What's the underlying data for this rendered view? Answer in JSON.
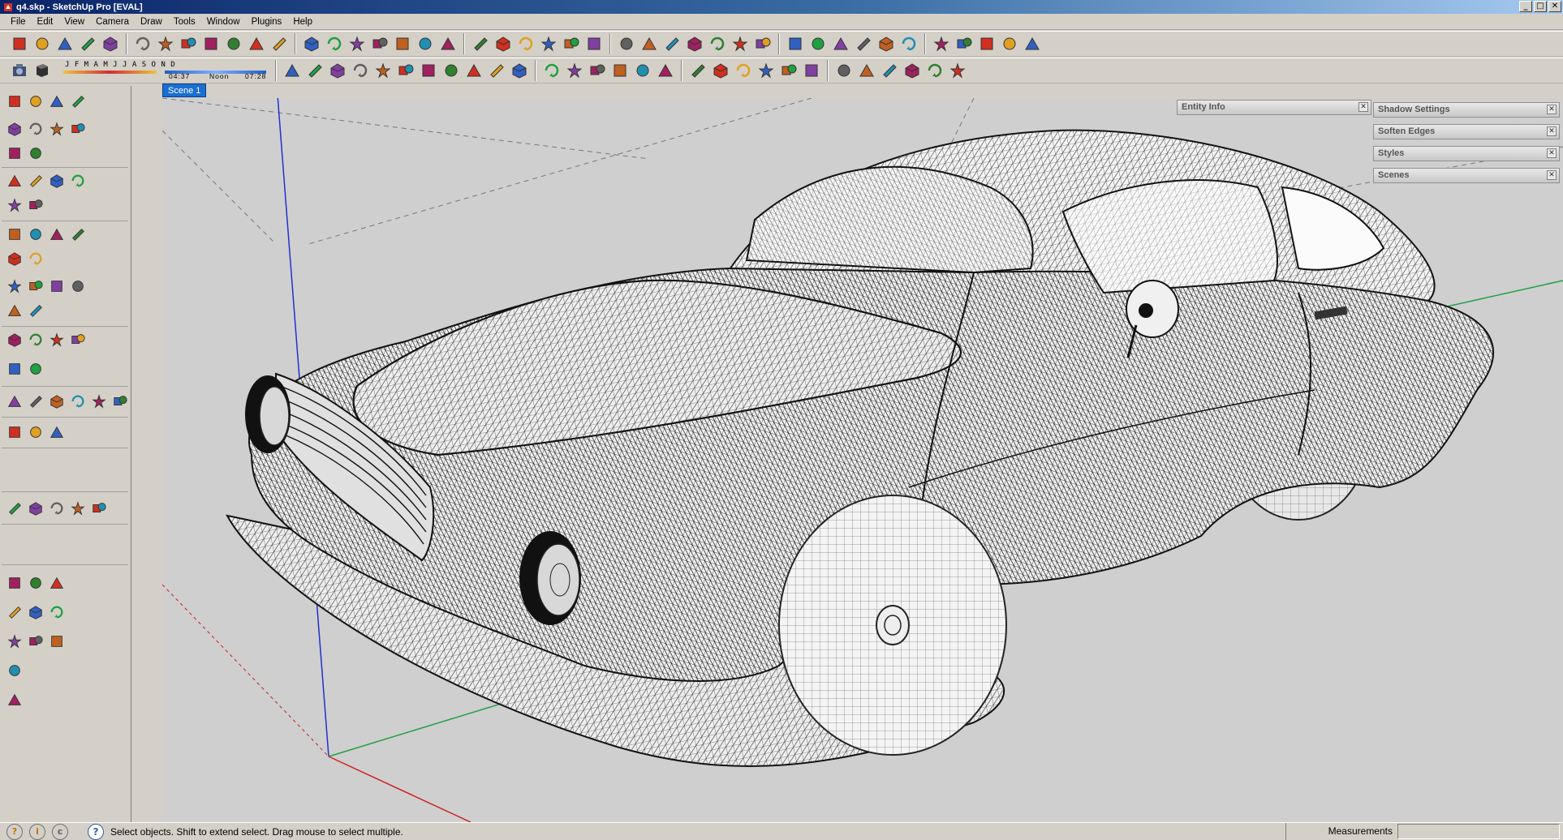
{
  "window": {
    "title": "q4.skp - SketchUp Pro [EVAL]",
    "controls": [
      "_",
      "□",
      "✕"
    ]
  },
  "menu": [
    "File",
    "Edit",
    "View",
    "Camera",
    "Draw",
    "Tools",
    "Window",
    "Plugins",
    "Help"
  ],
  "shadow": {
    "months": "J F M A M J J A S O N D",
    "time_start": "04:37",
    "time_mid": "Noon",
    "time_end": "07:28"
  },
  "scene_tab": "Scene 1",
  "panels": [
    {
      "label": "Entity Info"
    },
    {
      "label": "Shadow Settings"
    },
    {
      "label": "Soften Edges"
    },
    {
      "label": "Styles"
    },
    {
      "label": "Scenes"
    }
  ],
  "status": {
    "message": "Select objects. Shift to extend select. Drag mouse to select multiple.",
    "measurements_label": "Measurements",
    "measurements_value": ""
  },
  "colors": {
    "titlebar": "#0a246a",
    "viewport_bg": "#cfcfcf",
    "axis_red": "#d02020",
    "axis_green": "#20a040",
    "axis_blue": "#2030d0",
    "scene_tab": "#1a6fd0"
  },
  "icons": {
    "row1": [
      "select-icon",
      "pencil-icon",
      "rectangle-icon",
      "circle-icon",
      "arc-icon",
      "eraser-icon",
      "paint-bucket-icon",
      "tape-measure-icon",
      "push-pull-icon",
      "move-icon",
      "rotate-icon",
      "offset-icon",
      "orbit-icon",
      "pan-icon",
      "zoom-icon",
      "zoom-extents-icon",
      "section-plane-icon",
      "section-display-icon",
      "iso-view-icon",
      "top-view-icon",
      "front-view-icon",
      "right-view-icon",
      "back-view-icon",
      "left-view-icon",
      "xray-icon",
      "wireframe-icon",
      "hidden-line-icon",
      "shaded-icon",
      "textured-icon",
      "monochrome-icon",
      "sandbox-icon",
      "contour-icon",
      "smoove-icon",
      "stamp-icon",
      "drape-icon",
      "add-detail-icon",
      "flip-edge-icon",
      "ruby-icon",
      "gem-icon",
      "sphere-icon",
      "cone-icon",
      "torus-icon",
      "plugin-misc-icon"
    ],
    "row2": [
      "camera-icon",
      "shadow-toggle-icon",
      "curve-tools-icon",
      "spline-icon",
      "arc3-icon",
      "circle2-icon",
      "polygon-icon",
      "freehand-icon",
      "bezier-icon",
      "weld-icon",
      "split-icon",
      "extrude-icon",
      "follow-me-icon",
      "components-icon",
      "dimension-icon",
      "scale-icon",
      "flip-icon",
      "solid-tools-icon",
      "outer-shell-icon",
      "intersect-icon",
      "union-icon",
      "subtract-icon",
      "trim-icon",
      "split-solid-icon",
      "fredo-icon",
      "round-corner-icon",
      "joint-push-pull-icon",
      "subdivide-icon",
      "artisan-icon",
      "vertex-tools-icon",
      "tools-icon"
    ]
  }
}
